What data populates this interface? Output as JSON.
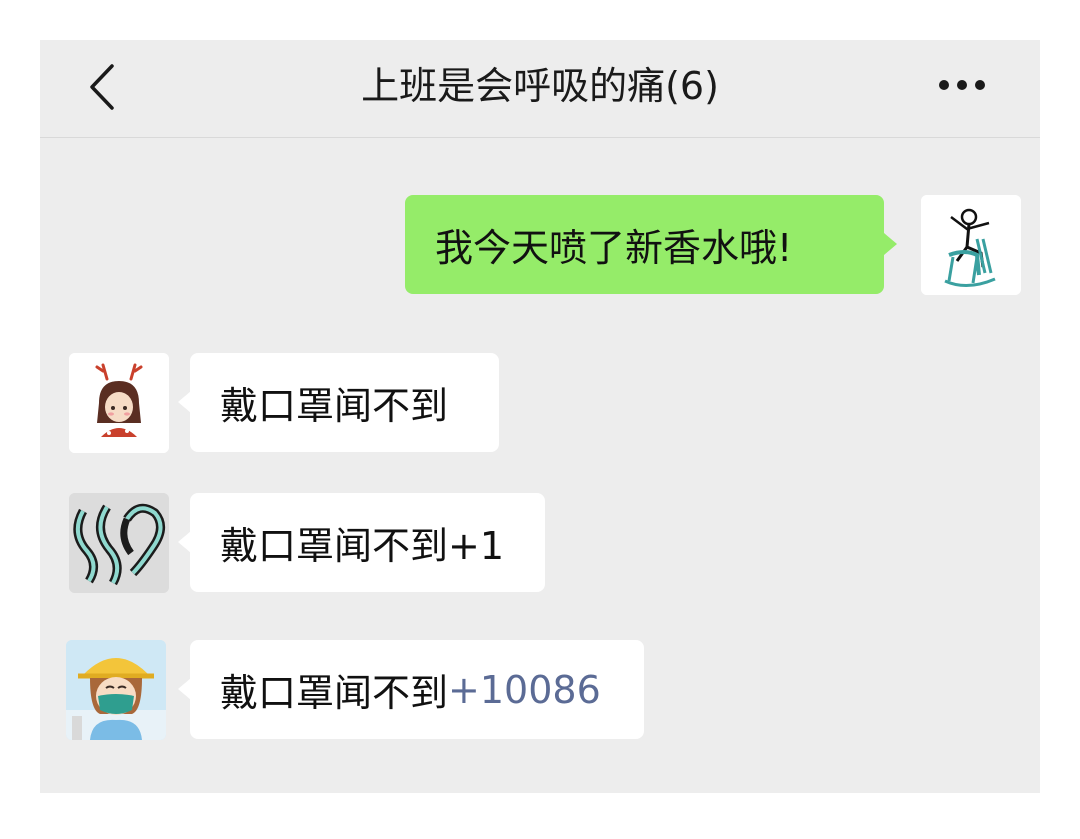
{
  "header": {
    "title": "上班是会呼吸的痛(6)",
    "back_icon": "chevron-left-icon",
    "more_icon": "more-dots-icon"
  },
  "messages": [
    {
      "sender": "self",
      "text": "我今天喷了新香水哦!",
      "avatar_icon": "rocking-chair-avatar"
    },
    {
      "sender": "other",
      "text": "戴口罩闻不到",
      "avatar_icon": "reindeer-girl-avatar"
    },
    {
      "sender": "other",
      "text": "戴口罩闻不到+1",
      "avatar_icon": "teal-swirl-avatar"
    },
    {
      "sender": "other",
      "text": "戴口罩闻不到",
      "text_highlight": "+10086",
      "avatar_icon": "masked-girl-avatar"
    }
  ],
  "colors": {
    "self_bubble": "#95ec69",
    "other_bubble": "#ffffff",
    "background": "#ededed",
    "highlight": "#5b6b95"
  }
}
